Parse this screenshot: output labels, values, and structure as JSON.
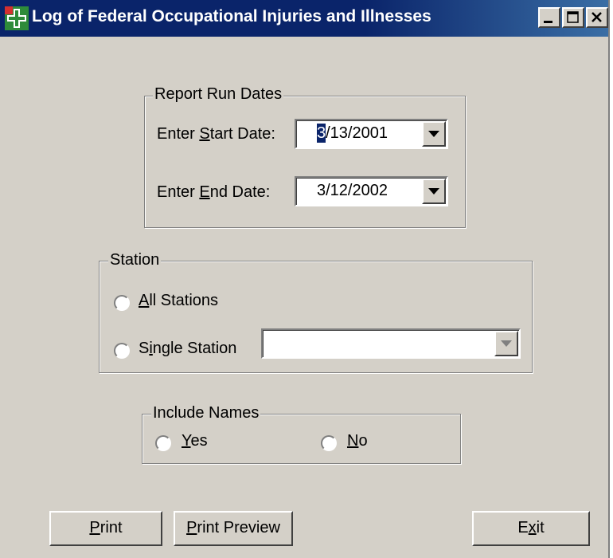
{
  "window": {
    "title": "Log of Federal Occupational Injuries and Illnesses",
    "minimize": "minimize",
    "maximize": "maximize",
    "close": "close"
  },
  "report_dates": {
    "group_label": "Report Run Dates",
    "start_label_pre": "Enter ",
    "start_label_key": "S",
    "start_label_post": "tart Date:",
    "start_value_sel": "3",
    "start_value_rest": "/13/2001",
    "end_label_pre": "Enter ",
    "end_label_key": "E",
    "end_label_post": "nd Date:",
    "end_value": "3/12/2002"
  },
  "station": {
    "group_label": "Station",
    "all_key": "A",
    "all_rest": "ll Stations",
    "single_pre": "S",
    "single_key": "i",
    "single_rest": "ngle Station",
    "single_value": ""
  },
  "names": {
    "group_label": "Include Names",
    "yes_key": "Y",
    "yes_rest": "es",
    "no_key": "N",
    "no_rest": "o"
  },
  "buttons": {
    "print_key": "P",
    "print_rest": "rint",
    "preview_key": "P",
    "preview_rest": "rint Preview",
    "exit_pre": "E",
    "exit_key": "x",
    "exit_rest": "it"
  },
  "colors": {
    "title_bar": "#0a246a",
    "face": "#d4d0c8",
    "selection": "#0a246a"
  },
  "icons": {
    "app": "medical-cross-icon",
    "dropdown": "chevron-down-icon"
  }
}
